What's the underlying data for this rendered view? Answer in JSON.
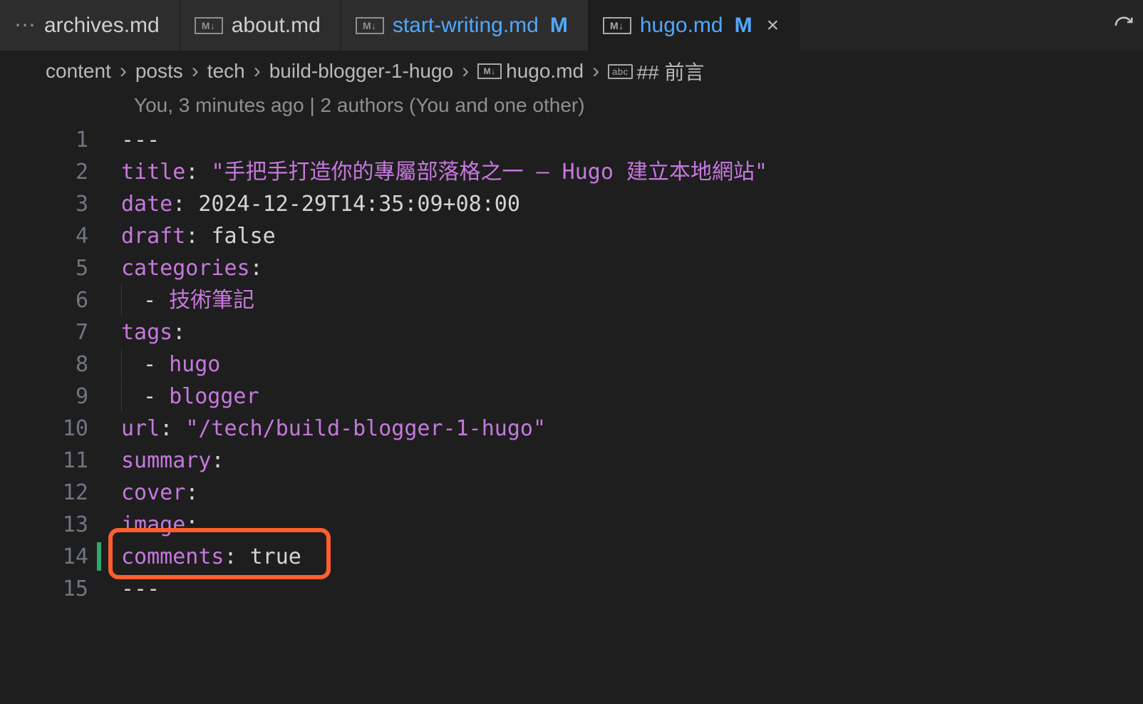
{
  "tabs": [
    {
      "label": "archives.md",
      "icon": "…",
      "modified": false,
      "active": false
    },
    {
      "label": "about.md",
      "icon": "M↓",
      "modified": false,
      "active": false
    },
    {
      "label": "start-writing.md",
      "icon": "M↓",
      "modified": true,
      "modMark": "M",
      "active": false,
      "accent": true
    },
    {
      "label": "hugo.md",
      "icon": "M↓",
      "modified": true,
      "modMark": "M",
      "active": true,
      "accent": true,
      "close": "×"
    }
  ],
  "breadcrumb": {
    "parts": [
      "content",
      "posts",
      "tech",
      "build-blogger-1-hugo"
    ],
    "fileIcon": "M↓",
    "file": "hugo.md",
    "outlineIcon": "abc",
    "outline": "## 前言"
  },
  "gitlens": "You, 3 minutes ago | 2 authors (You and one other)",
  "lines": {
    "l1": "---",
    "l2_key": "title",
    "l2_colon": ": ",
    "l2_val": "\"手把手打造你的專屬部落格之一 — Hugo 建立本地網站\"",
    "l3_key": "date",
    "l3_colon": ": ",
    "l3_val": "2024-12-29T14:35:09+08:00",
    "l4_key": "draft",
    "l4_colon": ": ",
    "l4_val": "false",
    "l5_key": "categories",
    "l5_colon": ":",
    "l6_dash": "- ",
    "l6_val": "技術筆記",
    "l7_key": "tags",
    "l7_colon": ":",
    "l8_dash": "- ",
    "l8_val": "hugo",
    "l9_dash": "- ",
    "l9_val": "blogger",
    "l10_key": "url",
    "l10_colon": ": ",
    "l10_val": "\"/tech/build-blogger-1-hugo\"",
    "l11_key": "summary",
    "l11_colon": ":",
    "l12_key": "cover",
    "l12_colon": ":",
    "l13_key": "image",
    "l13_colon": ":",
    "l14_key": "comments",
    "l14_colon": ": ",
    "l14_val": "true",
    "l15": "---"
  },
  "lineNumbers": [
    "1",
    "2",
    "3",
    "4",
    "5",
    "6",
    "7",
    "8",
    "9",
    "10",
    "11",
    "12",
    "13",
    "14",
    "15"
  ]
}
